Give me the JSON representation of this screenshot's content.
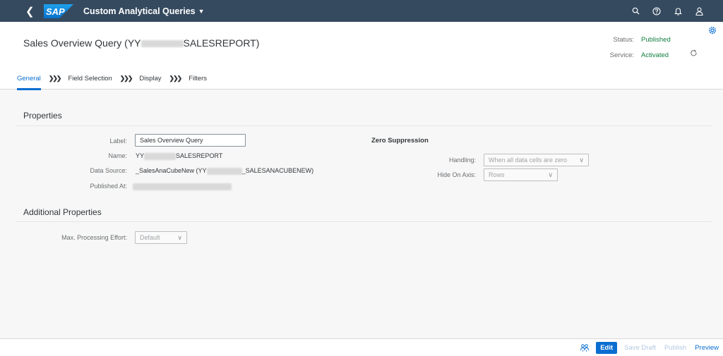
{
  "shell": {
    "logo_text": "SAP",
    "app_title": "Custom Analytical Queries"
  },
  "header": {
    "title_prefix": "Sales Overview Query (YY",
    "title_suffix": "SALESREPORT)",
    "status_label": "Status:",
    "status_value": "Published",
    "service_label": "Service:",
    "service_value": "Activated"
  },
  "tabs": [
    {
      "label": "General"
    },
    {
      "label": "Field Selection"
    },
    {
      "label": "Display"
    },
    {
      "label": "Filters"
    }
  ],
  "properties": {
    "section_title": "Properties",
    "label_label": "Label:",
    "label_value": "Sales Overview Query",
    "name_label": "Name:",
    "name_prefix": "YY",
    "name_suffix": "SALESREPORT",
    "datasource_label": "Data Source:",
    "datasource_prefix": "_SalesAnaCubeNew (YY",
    "datasource_suffix": "_SALESANACUBENEW)",
    "published_label": "Published At:"
  },
  "zero_suppression": {
    "title": "Zero Suppression",
    "handling_label": "Handling:",
    "handling_value": "When all data cells are zero",
    "axis_label": "Hide On Axis:",
    "axis_value": "Rows"
  },
  "additional": {
    "section_title": "Additional Properties",
    "effort_label": "Max. Processing Effort:",
    "effort_value": "Default"
  },
  "footer": {
    "edit_label": "Edit",
    "save_draft_label": "Save Draft",
    "publish_label": "Publish",
    "preview_label": "Preview"
  },
  "colors": {
    "shell": "#354a5f",
    "accent": "#0a6ed1",
    "positive": "#107e3e"
  }
}
